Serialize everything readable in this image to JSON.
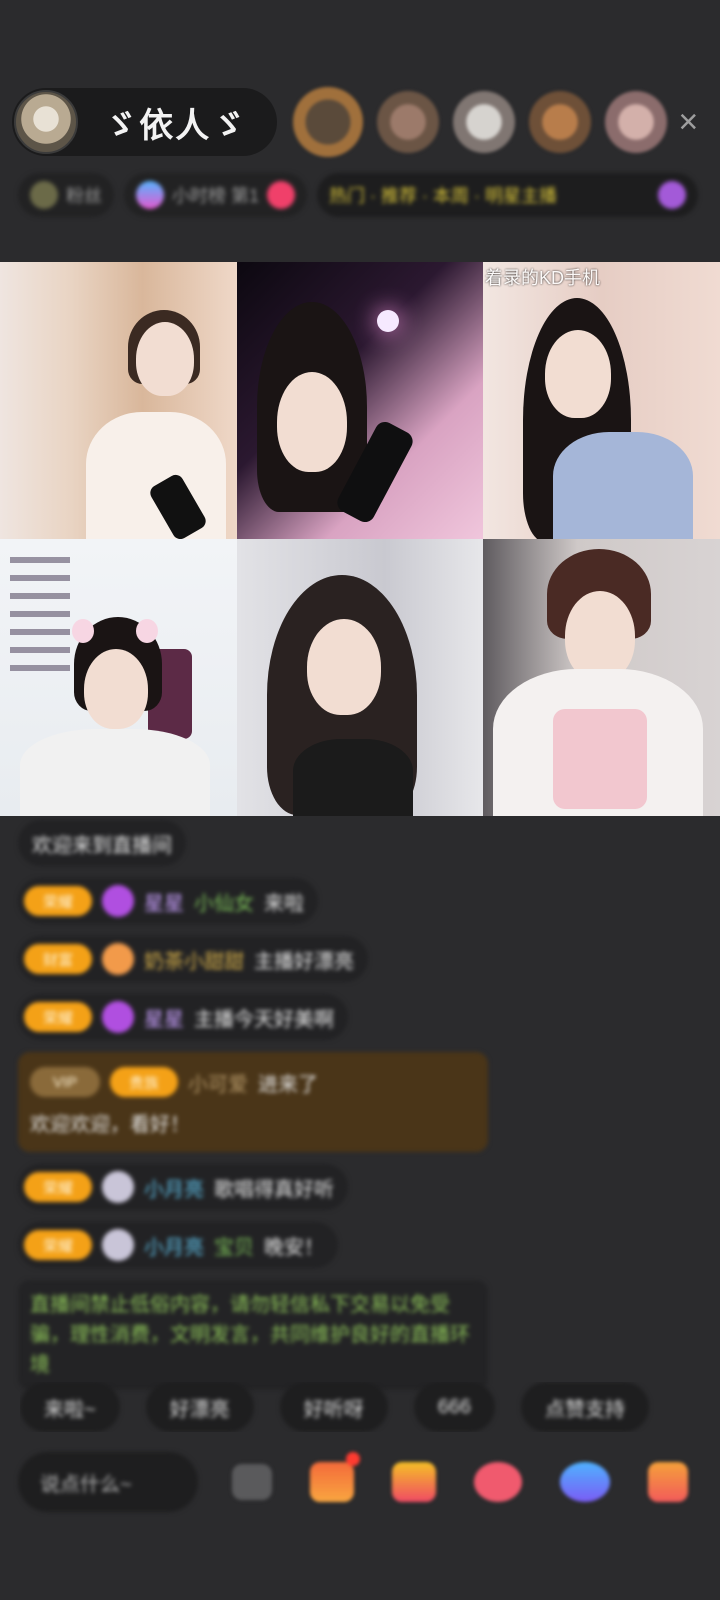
{
  "host": {
    "name": "ゞ依人ゞ"
  },
  "header": {
    "close_icon": "×"
  },
  "tags": {
    "t1": "粉丝",
    "t2": "小时榜 第1",
    "t3": "热门 · 推荐 · 本周 · 明星主播"
  },
  "video": {
    "tile3_overlay": "着录的KD手机"
  },
  "chat": {
    "m0": {
      "text": "欢迎来到直播间"
    },
    "m1": {
      "badge": "荣耀",
      "user": "星星",
      "to": "小仙女",
      "text": "来啦"
    },
    "m2": {
      "badge": "财富",
      "user": "奶茶小甜甜",
      "text": "主播好漂亮"
    },
    "m3": {
      "badge": "荣耀",
      "user": "星星",
      "text": "主播今天好美啊"
    },
    "m4": {
      "tag1": "VIP",
      "tag2": "贵族",
      "user": "小可爱",
      "text": "进来了",
      "line2": "欢迎欢迎，看好！"
    },
    "m5": {
      "badge": "荣耀",
      "user": "小月亮",
      "text": "歌唱得真好听"
    },
    "m6": {
      "badge": "荣耀",
      "user": "小月亮",
      "to": "宝贝",
      "text": "晚安！"
    },
    "notice": "直播间禁止低俗内容，请勿轻信私下交易以免受骗，理性消费，文明发言，共同维护良好的直播环境"
  },
  "quick_replies": [
    "来啦~",
    "好漂亮",
    "好听呀",
    "666",
    "点赞支持"
  ],
  "bottom": {
    "input_placeholder": "说点什么~"
  },
  "colors": {
    "badge": "#f4a117",
    "notice_text": "#8fc65a",
    "highlight_bg": "#4a3518"
  }
}
